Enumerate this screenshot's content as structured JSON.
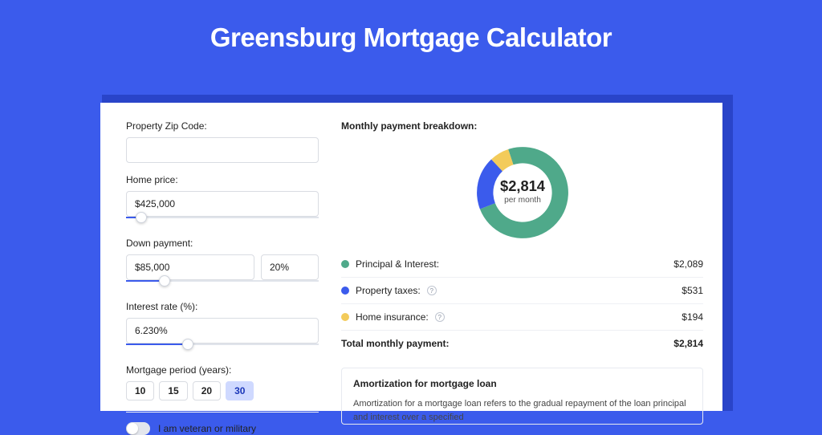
{
  "title": "Greensburg Mortgage Calculator",
  "colors": {
    "principal": "#4fa98a",
    "taxes": "#3b5bec",
    "insurance": "#f3cb5a"
  },
  "form": {
    "zip_label": "Property Zip Code:",
    "zip_value": "",
    "home_price_label": "Home price:",
    "home_price_value": "$425,000",
    "home_price_slider_pct": 8,
    "down_payment_label": "Down payment:",
    "down_payment_value": "$85,000",
    "down_payment_pct": "20%",
    "down_payment_slider_pct": 20,
    "interest_label": "Interest rate (%):",
    "interest_value": "6.230%",
    "interest_slider_pct": 32,
    "period_label": "Mortgage period (years):",
    "periods": [
      "10",
      "15",
      "20",
      "30"
    ],
    "period_active_index": 3,
    "veteran_label": "I am veteran or military",
    "veteran_on": false
  },
  "breakdown": {
    "title": "Monthly payment breakdown:",
    "center_value": "$2,814",
    "center_sub": "per month",
    "rows": [
      {
        "color_key": "principal",
        "label": "Principal & Interest:",
        "help": false,
        "value": "$2,089"
      },
      {
        "color_key": "taxes",
        "label": "Property taxes:",
        "help": true,
        "value": "$531"
      },
      {
        "color_key": "insurance",
        "label": "Home insurance:",
        "help": true,
        "value": "$194"
      }
    ],
    "total_label": "Total monthly payment:",
    "total_value": "$2,814"
  },
  "chart_data": {
    "type": "pie",
    "title": "Monthly payment breakdown",
    "series": [
      {
        "name": "Principal & Interest",
        "value": 2089
      },
      {
        "name": "Property taxes",
        "value": 531
      },
      {
        "name": "Home insurance",
        "value": 194
      }
    ],
    "total": 2814
  },
  "amortization": {
    "title": "Amortization for mortgage loan",
    "body": "Amortization for a mortgage loan refers to the gradual repayment of the loan principal and interest over a specified"
  }
}
